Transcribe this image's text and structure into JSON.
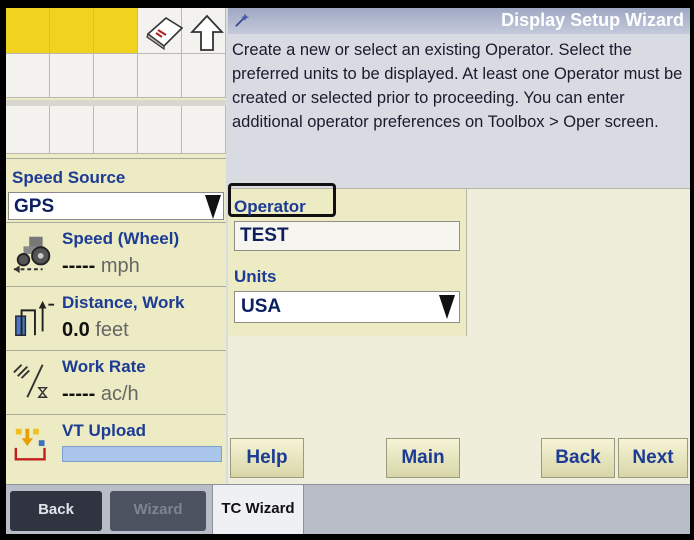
{
  "speed_source": {
    "label": "Speed Source",
    "value": "GPS"
  },
  "speed": {
    "title": "Speed (Wheel)",
    "value": "-----",
    "unit": "mph"
  },
  "distance": {
    "title": "Distance, Work",
    "value": "0.0",
    "unit": "feet"
  },
  "work_rate": {
    "title": "Work Rate",
    "value": "-----",
    "unit": "ac/h"
  },
  "vt_upload": {
    "title": "VT Upload",
    "progress": 1.0
  },
  "wizard": {
    "title": "Display Setup Wizard",
    "instructions": "Create a new or select an existing Operator. Select the preferred units to be displayed. At least one Operator must be created or selected prior to proceeding. You can enter additional operator preferences on Toolbox > Oper screen."
  },
  "form": {
    "operator_label": "Operator",
    "operator_value": "TEST",
    "units_label": "Units",
    "units_value": "USA"
  },
  "buttons": {
    "help": "Help",
    "main": "Main",
    "back": "Back",
    "next": "Next"
  },
  "tabs": {
    "back": "Back",
    "wizard": "Wizard",
    "tc_wizard": "TC Wizard"
  },
  "icons": {
    "shortcut": [
      "book-icon",
      "up-arrow-icon"
    ],
    "speed": "tractor-icon",
    "distance": "implement-icon",
    "work_rate": "work-rate-icon",
    "vt_upload": "vt-upload-icon",
    "header": "wizard-wand-icon"
  },
  "colors": {
    "accent_text": "#1c3b94",
    "shortcut_yellow": "#f0d21f",
    "panel_bg": "#ecebc4"
  }
}
